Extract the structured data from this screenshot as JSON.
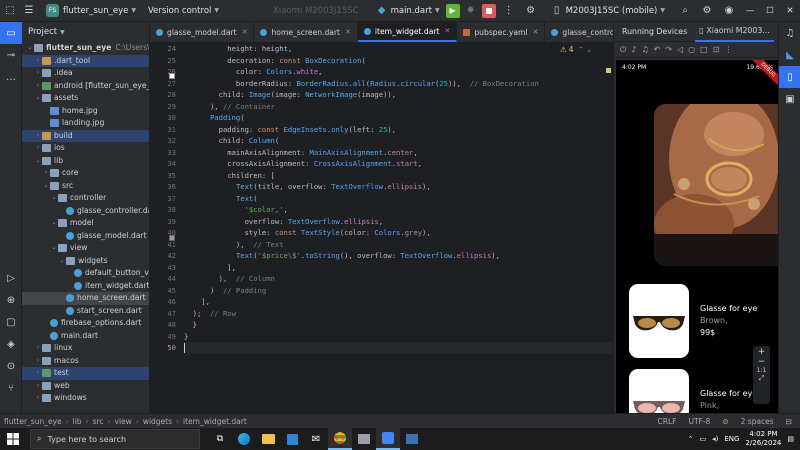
{
  "topbar": {
    "project_name": "flutter_sun_eye",
    "vcs_label": "Version control",
    "device_selector_ghost": "Xiaomi M2003J15SC",
    "run_config": "main.dart",
    "target_device": "M2003J15SC (mobile)"
  },
  "project_panel": {
    "title": "Project",
    "tree": [
      {
        "depth": 0,
        "label": "flutter_sun_eye",
        "suffix": "C:\\Users\\Kaiz",
        "icon": "folder",
        "expanded": true,
        "bold": true
      },
      {
        "depth": 1,
        "label": ".dart_tool",
        "icon": "folder-orange",
        "expanded": false,
        "row_style": "highlight"
      },
      {
        "depth": 1,
        "label": ".idea",
        "icon": "folder",
        "expanded": false
      },
      {
        "depth": 1,
        "label": "android [flutter_sun_eye_a",
        "icon": "folder-green",
        "expanded": false
      },
      {
        "depth": 1,
        "label": "assets",
        "icon": "folder",
        "expanded": true
      },
      {
        "depth": 2,
        "label": "home.jpg",
        "icon": "image"
      },
      {
        "depth": 2,
        "label": "landing.jpg",
        "icon": "image"
      },
      {
        "depth": 1,
        "label": "build",
        "icon": "folder-orange",
        "expanded": false,
        "row_style": "highlight"
      },
      {
        "depth": 1,
        "label": "ios",
        "icon": "folder",
        "expanded": false
      },
      {
        "depth": 1,
        "label": "lib",
        "icon": "folder",
        "expanded": true
      },
      {
        "depth": 2,
        "label": "core",
        "icon": "folder",
        "expanded": false
      },
      {
        "depth": 2,
        "label": "src",
        "icon": "folder",
        "expanded": true
      },
      {
        "depth": 3,
        "label": "controller",
        "icon": "folder",
        "expanded": true
      },
      {
        "depth": 4,
        "label": "glasse_controller.da",
        "icon": "dart"
      },
      {
        "depth": 3,
        "label": "model",
        "icon": "folder",
        "expanded": true
      },
      {
        "depth": 4,
        "label": "glasse_model.dart",
        "icon": "dart"
      },
      {
        "depth": 3,
        "label": "view",
        "icon": "folder",
        "expanded": true
      },
      {
        "depth": 4,
        "label": "widgets",
        "icon": "folder",
        "expanded": true
      },
      {
        "depth": 5,
        "label": "default_button_v",
        "icon": "dart"
      },
      {
        "depth": 5,
        "label": "item_widget.dart",
        "icon": "dart"
      },
      {
        "depth": 4,
        "label": "home_screen.dart",
        "icon": "dart",
        "row_style": "selected"
      },
      {
        "depth": 4,
        "label": "start_screen.dart",
        "icon": "dart"
      },
      {
        "depth": 2,
        "label": "firebase_options.dart",
        "icon": "dart"
      },
      {
        "depth": 2,
        "label": "main.dart",
        "icon": "dart"
      },
      {
        "depth": 1,
        "label": "linux",
        "icon": "folder",
        "expanded": false
      },
      {
        "depth": 1,
        "label": "macos",
        "icon": "folder",
        "expanded": false
      },
      {
        "depth": 1,
        "label": "test",
        "icon": "folder-green",
        "expanded": false,
        "row_style": "highlight"
      },
      {
        "depth": 1,
        "label": "web",
        "icon": "folder",
        "expanded": false
      },
      {
        "depth": 1,
        "label": "windows",
        "icon": "folder",
        "expanded": false
      }
    ]
  },
  "editor": {
    "tabs": [
      {
        "label": "glasse_model.dart",
        "type": "dart",
        "active": false
      },
      {
        "label": "home_screen.dart",
        "type": "dart",
        "active": false
      },
      {
        "label": "item_widget.dart",
        "type": "dart",
        "active": true
      },
      {
        "label": "pubspec.yaml",
        "type": "yaml",
        "active": false
      },
      {
        "label": "glasse_controller.dart",
        "type": "dart",
        "active": false
      }
    ],
    "warning_count": "4",
    "first_line_number": 24,
    "current_line_number": 50,
    "lines": [
      [
        [
          "plain",
          "          height: height,"
        ]
      ],
      [
        [
          "plain",
          "          decoration: "
        ],
        [
          "kw",
          "const "
        ],
        [
          "ty",
          "BoxDecoration"
        ],
        [
          "plain",
          "("
        ]
      ],
      [
        [
          "plain",
          "            color: "
        ],
        [
          "ty",
          "Colors"
        ],
        [
          "plain",
          "."
        ],
        [
          "prop",
          "white"
        ],
        [
          "plain",
          ","
        ]
      ],
      [
        [
          "plain",
          "            borderRadius: "
        ],
        [
          "ty",
          "BorderRadius"
        ],
        [
          "plain",
          "."
        ],
        [
          "fn",
          "all"
        ],
        [
          "plain",
          "("
        ],
        [
          "ty",
          "Radius"
        ],
        [
          "plain",
          "."
        ],
        [
          "fn",
          "circular"
        ],
        [
          "plain",
          "("
        ],
        [
          "num",
          "25"
        ],
        [
          "plain",
          ")), "
        ],
        [
          "cm",
          " // BoxDecoration"
        ]
      ],
      [
        [
          "plain",
          "        child: "
        ],
        [
          "ty",
          "Image"
        ],
        [
          "plain",
          "(image: "
        ],
        [
          "ty",
          "NetworkImage"
        ],
        [
          "plain",
          "(image)),"
        ]
      ],
      [
        [
          "plain",
          "      ), "
        ],
        [
          "cm",
          "// Container"
        ]
      ],
      [
        [
          "plain",
          "      "
        ],
        [
          "ty",
          "Padding"
        ],
        [
          "plain",
          "("
        ]
      ],
      [
        [
          "plain",
          "        padding: "
        ],
        [
          "kw",
          "const "
        ],
        [
          "ty",
          "EdgeInsets"
        ],
        [
          "plain",
          "."
        ],
        [
          "fn",
          "only"
        ],
        [
          "plain",
          "(left: "
        ],
        [
          "num",
          "25"
        ],
        [
          "plain",
          "),"
        ]
      ],
      [
        [
          "plain",
          "        child: "
        ],
        [
          "ty",
          "Column"
        ],
        [
          "plain",
          "("
        ]
      ],
      [
        [
          "plain",
          "          mainAxisAlignment: "
        ],
        [
          "ty",
          "MainAxisAlignment"
        ],
        [
          "plain",
          "."
        ],
        [
          "prop",
          "center"
        ],
        [
          "plain",
          ","
        ]
      ],
      [
        [
          "plain",
          "          crossAxisAlignment: "
        ],
        [
          "ty",
          "CrossAxisAlignment"
        ],
        [
          "plain",
          "."
        ],
        [
          "prop",
          "start"
        ],
        [
          "plain",
          ","
        ]
      ],
      [
        [
          "plain",
          "          children: ["
        ]
      ],
      [
        [
          "plain",
          "            "
        ],
        [
          "ty",
          "Text"
        ],
        [
          "plain",
          "(title, overflow: "
        ],
        [
          "ty",
          "TextOverflow"
        ],
        [
          "plain",
          "."
        ],
        [
          "prop",
          "ellipsis"
        ],
        [
          "plain",
          "),"
        ]
      ],
      [
        [
          "plain",
          "            "
        ],
        [
          "ty",
          "Text"
        ],
        [
          "plain",
          "("
        ]
      ],
      [
        [
          "plain",
          "              "
        ],
        [
          "str",
          "'$color,'"
        ],
        [
          "plain",
          ","
        ]
      ],
      [
        [
          "plain",
          "              overflow: "
        ],
        [
          "ty",
          "TextOverflow"
        ],
        [
          "plain",
          "."
        ],
        [
          "prop",
          "ellipsis"
        ],
        [
          "plain",
          ","
        ]
      ],
      [
        [
          "plain",
          "              style: "
        ],
        [
          "kw",
          "const "
        ],
        [
          "ty",
          "TextStyle"
        ],
        [
          "plain",
          "(color: "
        ],
        [
          "ty",
          "Colors"
        ],
        [
          "plain",
          "."
        ],
        [
          "prop",
          "grey"
        ],
        [
          "plain",
          "),"
        ]
      ],
      [
        [
          "plain",
          "            ), "
        ],
        [
          "cm",
          " // Text"
        ]
      ],
      [
        [
          "plain",
          "            "
        ],
        [
          "ty",
          "Text"
        ],
        [
          "plain",
          "("
        ],
        [
          "str",
          "'$price\\$'"
        ],
        [
          "plain",
          "."
        ],
        [
          "fn",
          "toString"
        ],
        [
          "plain",
          "(), overflow: "
        ],
        [
          "ty",
          "TextOverflow"
        ],
        [
          "plain",
          "."
        ],
        [
          "prop",
          "ellipsis"
        ],
        [
          "plain",
          "),"
        ]
      ],
      [
        [
          "plain",
          "          ],"
        ]
      ],
      [
        [
          "plain",
          "        ), "
        ],
        [
          "cm",
          " // Column"
        ]
      ],
      [
        [
          "plain",
          "      ) "
        ],
        [
          "cm",
          " // Padding"
        ]
      ],
      [
        [
          "plain",
          "    ],"
        ]
      ],
      [
        [
          "plain",
          "  ); "
        ],
        [
          "cm",
          " // Row"
        ]
      ],
      [
        [
          "plain",
          "  }"
        ]
      ],
      [
        [
          "plain",
          "}"
        ]
      ],
      [
        [
          "plain",
          ""
        ]
      ]
    ]
  },
  "devices_panel": {
    "title": "Running Devices",
    "device_tab": "Xiaomi M2003...",
    "phone": {
      "time": "4:02 PM",
      "net": "19.6KB/s",
      "debug_banner": "DEBUG",
      "products": [
        {
          "name": "Glasse for eye",
          "color": "Brown,",
          "price": "99$"
        },
        {
          "name": "Glasse for eye",
          "color": "Pink,",
          "price": ""
        }
      ],
      "zoom_ratio": "1:1"
    }
  },
  "statusbar": {
    "breadcrumbs": [
      "flutter_sun_eye",
      "lib",
      "src",
      "view",
      "widgets",
      "item_widget.dart"
    ],
    "line_sep": "CRLF",
    "encoding": "UTF-8",
    "indent": "2 spaces"
  },
  "taskbar": {
    "search_placeholder": "Type here to search",
    "lang": "ENG",
    "time": "4:02 PM",
    "date": "2/26/2024"
  },
  "colors": {
    "accent": "#3574f0",
    "run_green": "#5fb832",
    "stop_red": "#db5c5c"
  }
}
